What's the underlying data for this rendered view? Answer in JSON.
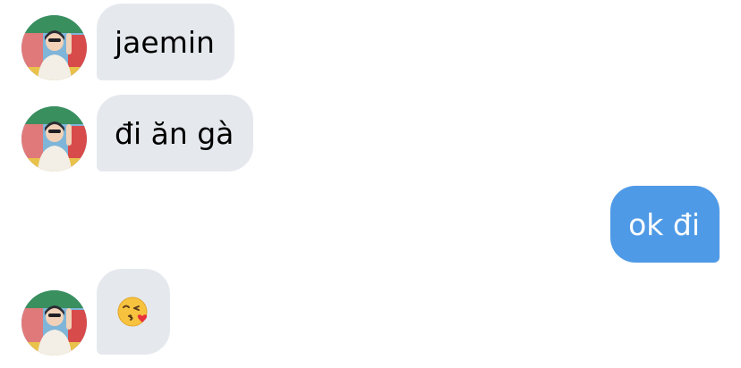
{
  "colors": {
    "incoming_bubble": "#e5e9ee",
    "outgoing_bubble": "#4f9ae6",
    "outgoing_text": "#ffffff",
    "incoming_text": "#000000"
  },
  "messages": [
    {
      "direction": "incoming",
      "text": "jaemin",
      "show_avatar": true
    },
    {
      "direction": "incoming",
      "text": "đi ăn gà",
      "show_avatar": true
    },
    {
      "direction": "outgoing",
      "text": "ok đi"
    },
    {
      "direction": "incoming",
      "emoji": "kissing-face-with-heart-emoji",
      "show_avatar": true
    }
  ]
}
